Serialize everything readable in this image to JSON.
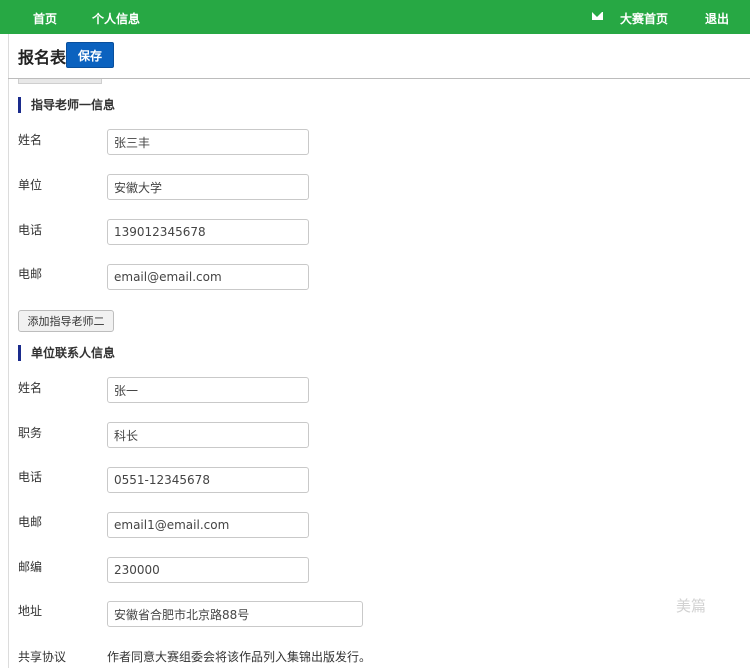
{
  "nav": {
    "home": "首页",
    "profile": "个人信息",
    "contest_home": "大赛首页",
    "logout": "退出"
  },
  "page": {
    "title": "报名表",
    "save_label": "保存"
  },
  "advisor": {
    "heading": "指导老师一信息",
    "name_label": "姓名",
    "name_value": "张三丰",
    "org_label": "单位",
    "org_value": "安徽大学",
    "phone_label": "电话",
    "phone_value": "13901234567​8",
    "email_label": "电邮",
    "email_value": "email@email.com",
    "add_second_label": "添加指导老师二"
  },
  "contact": {
    "heading": "单位联系人信息",
    "name_label": "姓名",
    "name_value": "张一",
    "title_label": "职务",
    "title_value": "科长",
    "phone_label": "电话",
    "phone_value": "0551-12345678",
    "email_label": "电邮",
    "email_value": "email1@email.com",
    "zip_label": "邮编",
    "zip_value": "230000",
    "address_label": "地址",
    "address_value": "安徽省合肥市北京路88号"
  },
  "share": {
    "label": "共享协议",
    "text": "作者同意大赛组委会将该作品列入集锦出版发行。"
  },
  "watermark": "美篇",
  "colors": {
    "nav_bg": "#27a844",
    "save_bg": "#0b62bf",
    "section_marker": "#1a2b8c"
  }
}
